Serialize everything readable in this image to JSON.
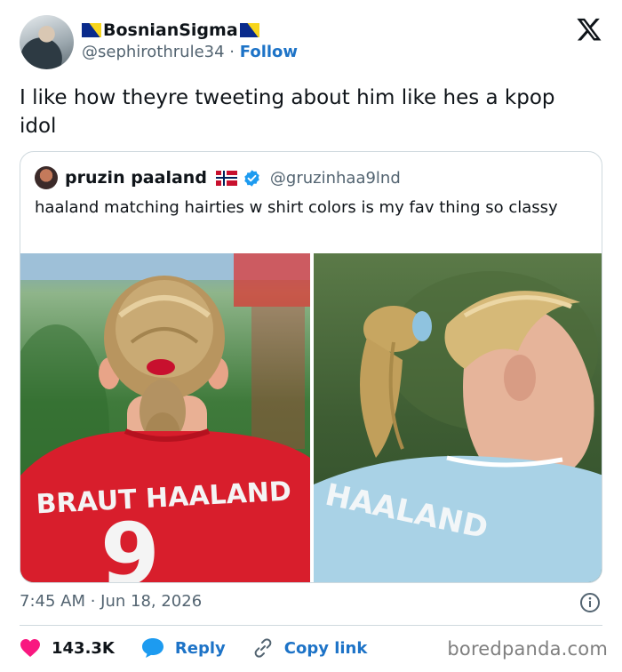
{
  "author": {
    "display_name": "BosnianSigma",
    "handle": "@sephirothrule34",
    "separator": "·",
    "follow_label": "Follow"
  },
  "tweet": {
    "text": "I like how theyre tweeting about him like hes a kpop idol"
  },
  "quoted_tweet": {
    "display_name": "pruzin paaland",
    "handle": "@gruzinhaa9lnd",
    "text": "haaland matching hairties w shirt colors is my fav thing so classy",
    "images": [
      {
        "jersey_text": "BRAUT HAALAND",
        "jersey_number": "9",
        "shirt_color": "#d81e2c",
        "hairtie_color": "#c8102e"
      },
      {
        "jersey_text": "HAALAND",
        "shirt_color": "#a9d2e6",
        "hairtie_color": "#8fc3df"
      }
    ]
  },
  "meta": {
    "time": "7:45 AM · Jun 18, 2026"
  },
  "actions": {
    "likes": "143.3K",
    "reply_label": "Reply",
    "copy_link_label": "Copy link"
  },
  "watermark": "boredpanda.com",
  "colors": {
    "link_blue": "#1d73c7",
    "like_pink": "#f91880",
    "text_dark": "#0f1419",
    "text_gray": "#536471",
    "border": "#cfd9de"
  },
  "icons": {
    "logo": "x-logo-icon",
    "verified": "verified-badge-icon",
    "info": "info-icon",
    "like": "heart-icon",
    "reply": "speech-bubble-icon",
    "copy": "link-icon"
  }
}
